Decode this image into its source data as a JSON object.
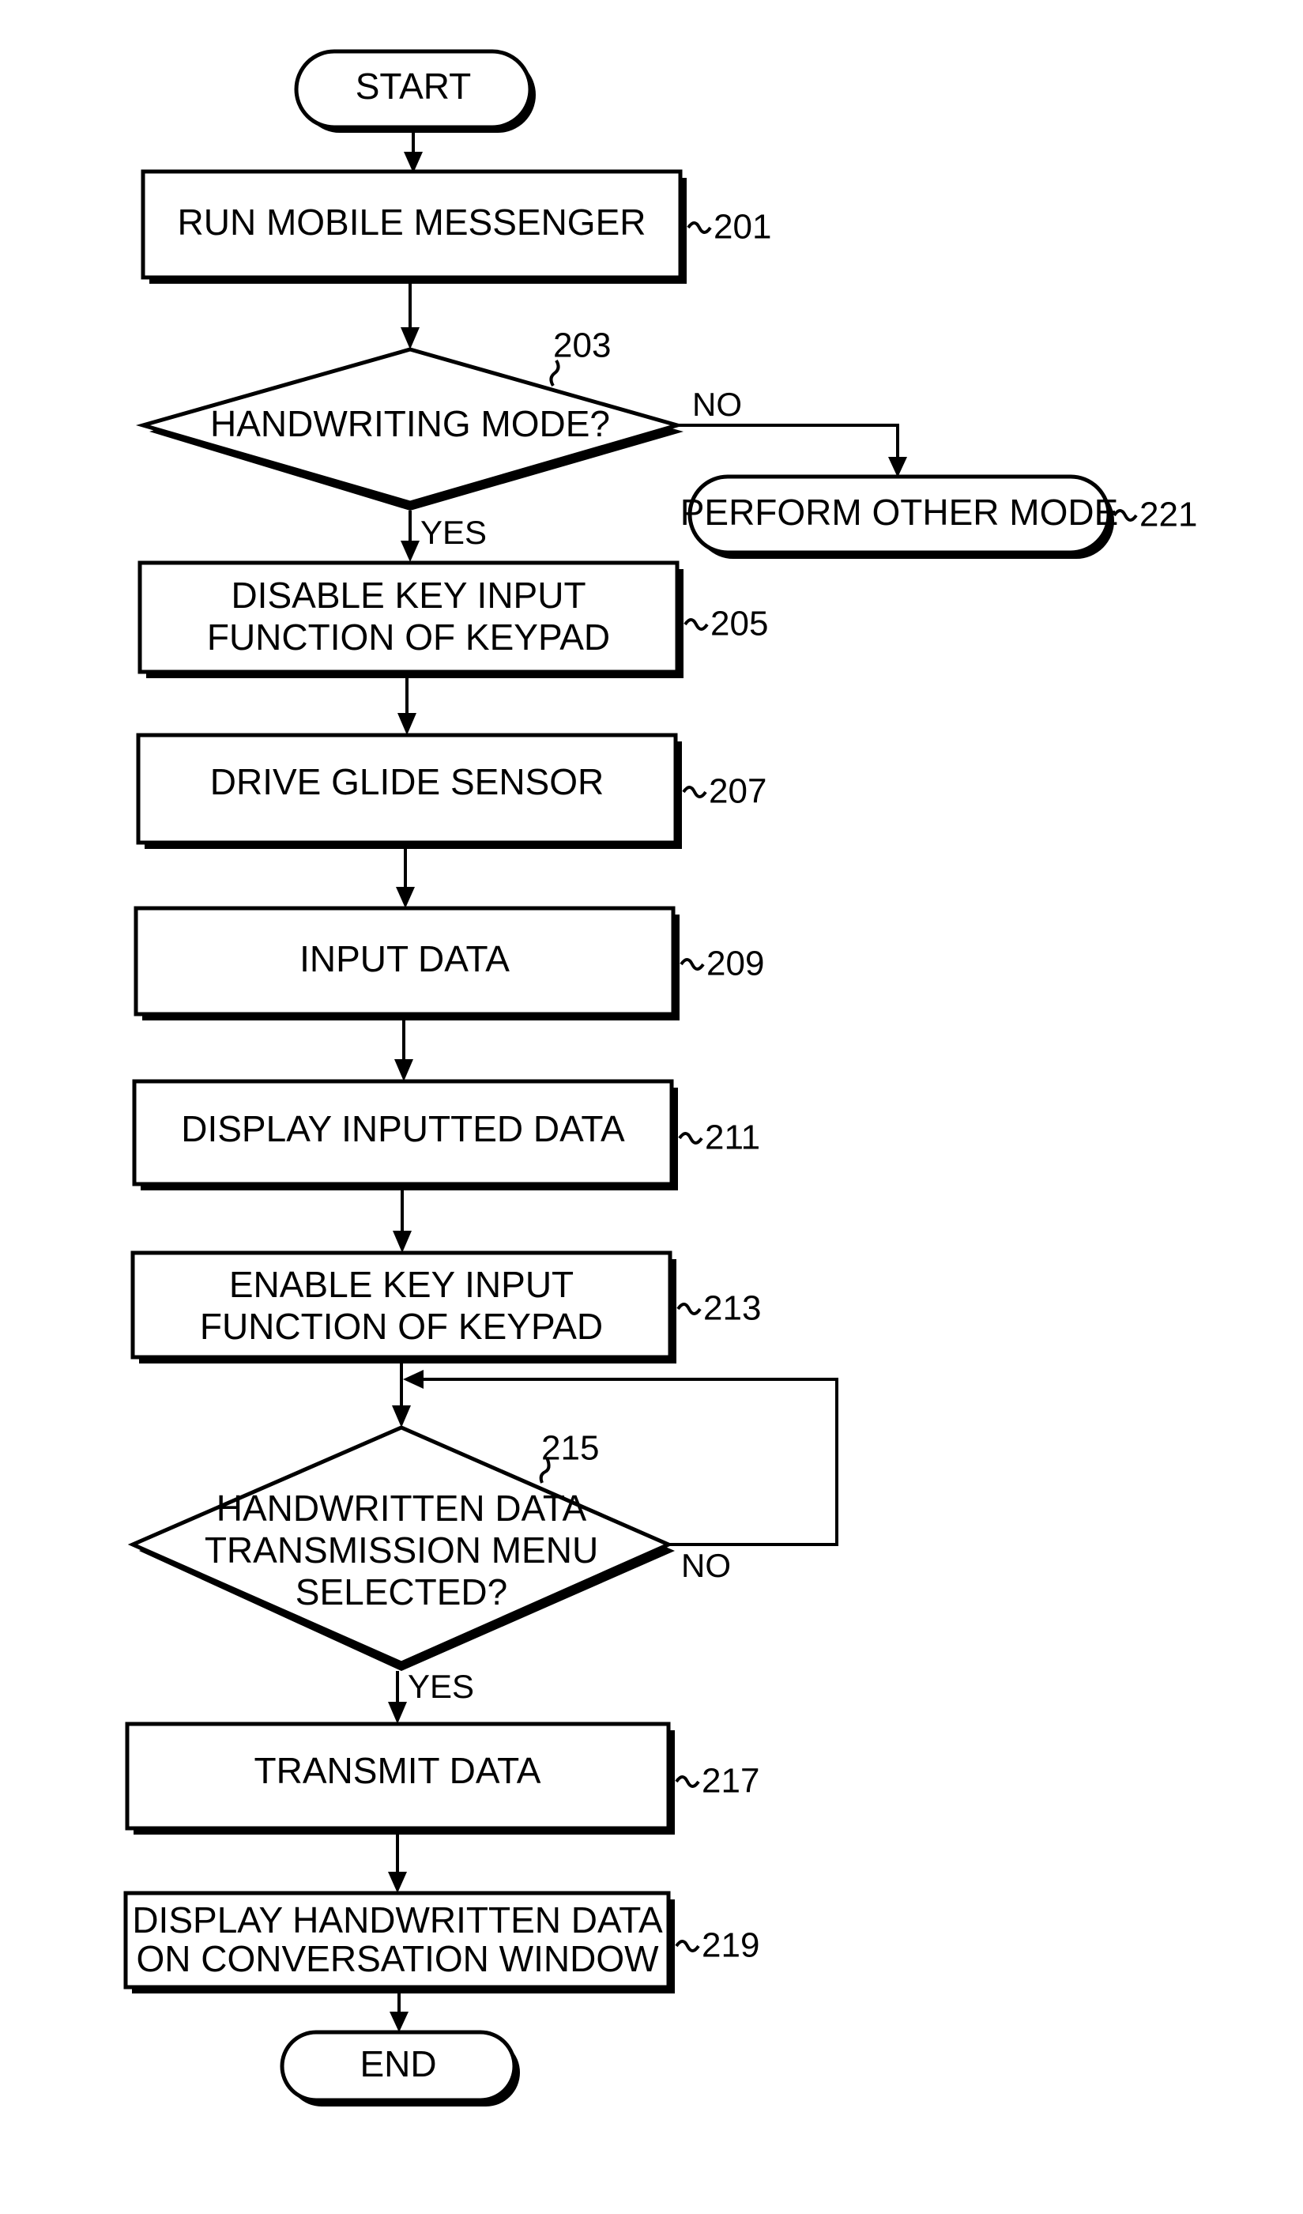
{
  "diagram": {
    "type": "flowchart",
    "nodes": {
      "start": {
        "shape": "terminal",
        "text": "START"
      },
      "s201": {
        "shape": "process",
        "ref": "201",
        "lines": [
          "RUN MOBILE MESSENGER"
        ]
      },
      "s203": {
        "shape": "decision",
        "ref": "203",
        "lines": [
          "HANDWRITING MODE?"
        ]
      },
      "s221": {
        "shape": "terminal",
        "ref": "221",
        "lines": [
          "PERFORM OTHER MODE"
        ]
      },
      "s205": {
        "shape": "process",
        "ref": "205",
        "lines": [
          "DISABLE KEY INPUT",
          "FUNCTION OF KEYPAD"
        ]
      },
      "s207": {
        "shape": "process",
        "ref": "207",
        "lines": [
          "DRIVE GLIDE SENSOR"
        ]
      },
      "s209": {
        "shape": "process",
        "ref": "209",
        "lines": [
          "INPUT DATA"
        ]
      },
      "s211": {
        "shape": "process",
        "ref": "211",
        "lines": [
          "DISPLAY INPUTTED DATA"
        ]
      },
      "s213": {
        "shape": "process",
        "ref": "213",
        "lines": [
          "ENABLE KEY INPUT",
          "FUNCTION OF KEYPAD"
        ]
      },
      "s215": {
        "shape": "decision",
        "ref": "215",
        "lines": [
          "HANDWRITTEN DATA",
          "TRANSMISSION MENU",
          "SELECTED?"
        ]
      },
      "s217": {
        "shape": "process",
        "ref": "217",
        "lines": [
          "TRANSMIT DATA"
        ]
      },
      "s219": {
        "shape": "process",
        "ref": "219",
        "lines": [
          "DISPLAY HANDWRITTEN DATA",
          "ON CONVERSATION WINDOW"
        ]
      },
      "end": {
        "shape": "terminal",
        "text": "END"
      }
    },
    "edges": {
      "e203_no": {
        "from": "203",
        "to": "221",
        "label": "NO"
      },
      "e203_yes": {
        "from": "203",
        "to": "205",
        "label": "YES"
      },
      "e215_no": {
        "from": "215",
        "to": "215",
        "label": "NO"
      },
      "e215_yes": {
        "from": "215",
        "to": "217",
        "label": "YES"
      }
    }
  }
}
